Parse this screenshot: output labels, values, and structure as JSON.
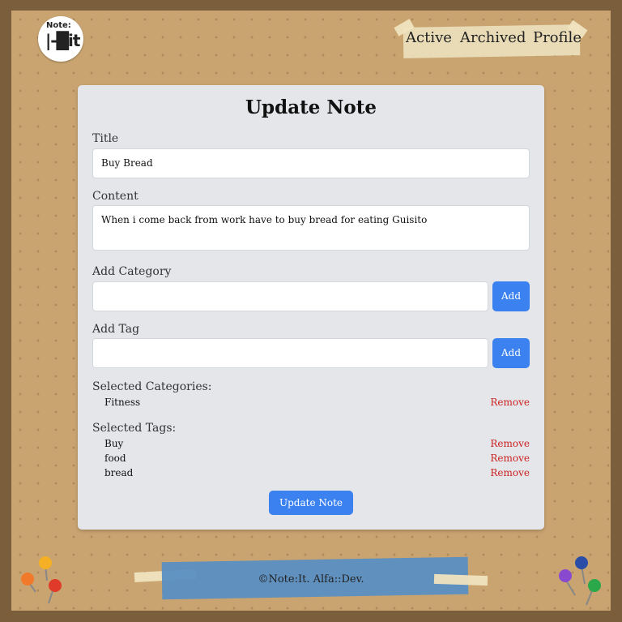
{
  "logo": {
    "line1": "Note:",
    "line2": "|-█it"
  },
  "nav": {
    "items": [
      "Active",
      "Archived",
      "Profile"
    ]
  },
  "form": {
    "title": "Update Note",
    "title_label": "Title",
    "title_value": "Buy Bread",
    "content_label": "Content",
    "content_value": "When i come back from work have to buy bread for eating Guisito",
    "category_label": "Add Category",
    "category_value": "",
    "tag_label": "Add Tag",
    "tag_value": "",
    "add_label": "Add",
    "selected_categories_label": "Selected Categories:",
    "categories": [
      {
        "name": "Fitness",
        "remove": "Remove"
      }
    ],
    "selected_tags_label": "Selected Tags:",
    "tags": [
      {
        "name": "Buy",
        "remove": "Remove"
      },
      {
        "name": "food",
        "remove": "Remove"
      },
      {
        "name": "bread",
        "remove": "Remove"
      }
    ],
    "submit_label": "Update Note"
  },
  "footer": {
    "text": "©Note:It. Alfa::Dev."
  },
  "colors": {
    "board": "#c9a470",
    "frame": "#7b5e3b",
    "card": "#e4e6ea",
    "accent": "#3b82f0",
    "remove": "#cc2222",
    "footer_tape": "#5a8fc2"
  }
}
